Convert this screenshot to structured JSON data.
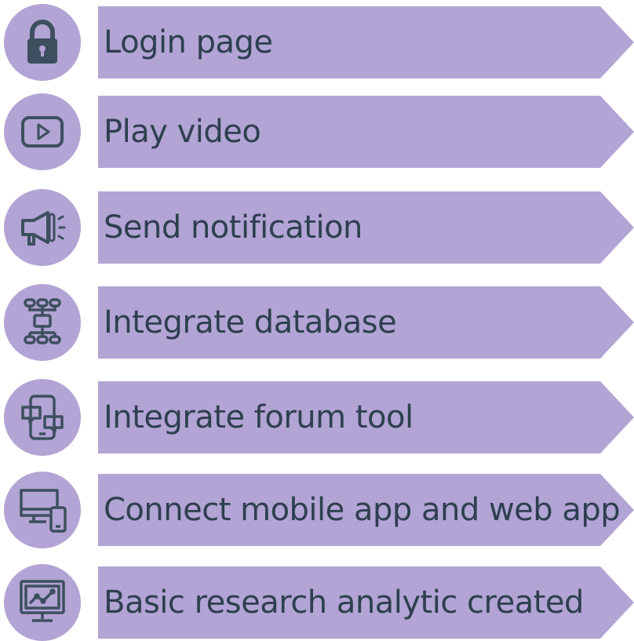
{
  "colors": {
    "banner": "#b2a4d4",
    "circle": "#b2a4d4",
    "text": "#2e3f4f",
    "icon": "#3d4f5f"
  },
  "steps": [
    {
      "label": "Login page",
      "icon": "lock-icon"
    },
    {
      "label": "Play video",
      "icon": "play-video-icon"
    },
    {
      "label": "Send notification",
      "icon": "megaphone-icon"
    },
    {
      "label": "Integrate database",
      "icon": "database-hierarchy-icon"
    },
    {
      "label": "Integrate forum tool",
      "icon": "forum-chat-icon"
    },
    {
      "label": "Connect mobile app and web app",
      "icon": "desktop-mobile-icon"
    },
    {
      "label": "Basic research analytic created",
      "icon": "analytics-monitor-icon"
    }
  ]
}
